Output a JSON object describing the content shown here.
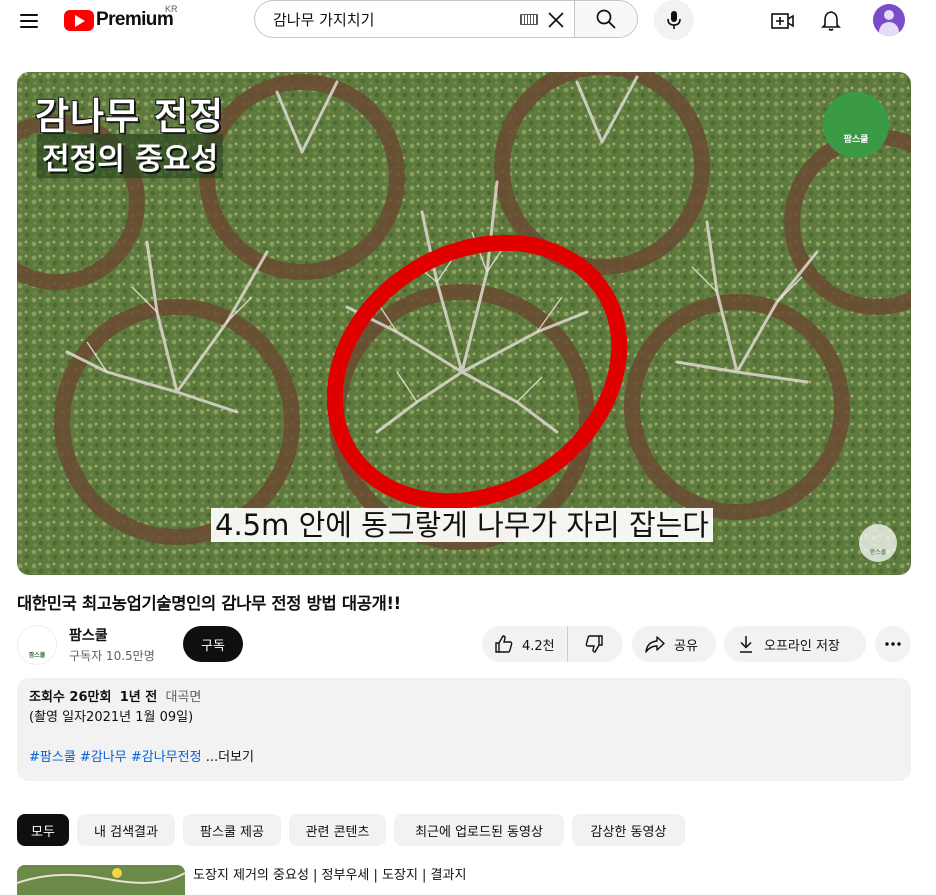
{
  "masthead": {
    "logo_text": "Premium",
    "region": "KR",
    "search_value": "감나무 가지치기"
  },
  "player": {
    "overlay_title": "감나무 전정",
    "overlay_subtitle_box": "전정의 중요성",
    "caption": "4.5m 안에 동그랗게 나무가 자리 잡는다",
    "badge_text": "팜스쿨",
    "watermark_text": "팜스쿨"
  },
  "video": {
    "title": "대한민국 최고농업기술명인의 감나무 전정 방법 대공개!!"
  },
  "owner": {
    "channel_name": "팜스쿨",
    "subscribers": "구독자 10.5만명",
    "avatar_text": "팜스쿨",
    "subscribe_label": "구독"
  },
  "actions": {
    "like_count": "4.2천",
    "share_label": "공유",
    "download_label": "오프라인 저장"
  },
  "description": {
    "views": "조회수 26만회",
    "age": "1년 전",
    "location": "대곡면",
    "line2": "(촬영 일자2021년 1월 09일)",
    "tag1": "#팜스쿨",
    "tag2": "#감나무",
    "tag3": "#감나무전정",
    "more": "...더보기"
  },
  "chips": [
    "모두",
    "내 검색결과",
    "팜스쿨 제공",
    "관련 콘텐츠",
    "최근에 업로드된 동영상",
    "감상한 동영상"
  ],
  "related": {
    "title": "도장지 제거의 중요성 | 정부우세 | 도장지 | 결과지"
  }
}
